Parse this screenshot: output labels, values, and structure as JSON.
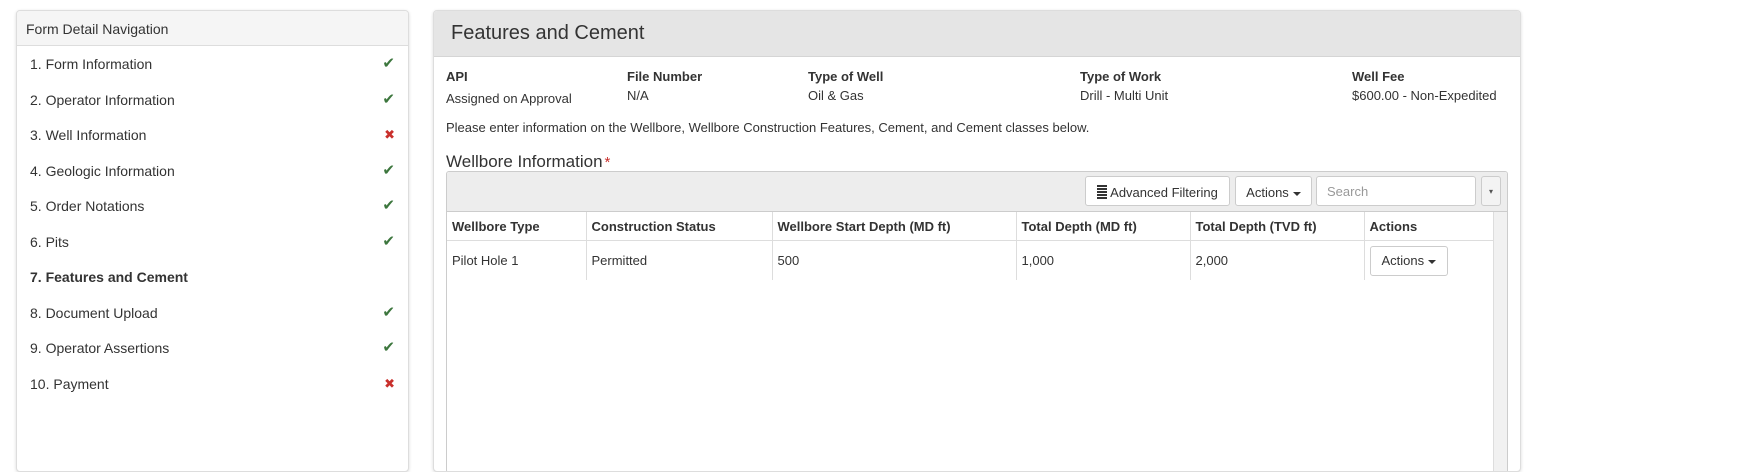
{
  "sidebar": {
    "title": "Form Detail Navigation",
    "items": [
      {
        "label": "1. Form Information",
        "status": "ok"
      },
      {
        "label": "2. Operator Information",
        "status": "ok"
      },
      {
        "label": "3. Well Information",
        "status": "bad"
      },
      {
        "label": "4. Geologic Information",
        "status": "ok"
      },
      {
        "label": "5. Order Notations",
        "status": "ok"
      },
      {
        "label": "6. Pits",
        "status": "ok"
      },
      {
        "label": "7. Features and Cement",
        "status": "active"
      },
      {
        "label": "8. Document Upload",
        "status": "ok"
      },
      {
        "label": "9. Operator Assertions",
        "status": "ok"
      },
      {
        "label": "10. Payment",
        "status": "bad"
      }
    ],
    "check_icon": "✔",
    "cross_icon": "✖"
  },
  "main": {
    "title": "Features and Cement",
    "info": {
      "api": {
        "label": "API",
        "value": "Assigned on Approval"
      },
      "file_number": {
        "label": "File Number",
        "value": "N/A"
      },
      "type_of_well": {
        "label": "Type of Well",
        "value": "Oil & Gas"
      },
      "type_of_work": {
        "label": "Type of Work",
        "value": "Drill - Multi Unit"
      },
      "well_fee": {
        "label": "Well Fee",
        "value": "$600.00 - Non-Expedited"
      }
    },
    "instructions": "Please enter information on the Wellbore, Wellbore Construction Features, Cement, and Cement classes below.",
    "section_title": "Wellbore Information",
    "required_marker": "*"
  },
  "grid": {
    "toolbar": {
      "advanced_filtering": "Advanced Filtering",
      "actions": "Actions",
      "search_placeholder": "Search",
      "dropdown_glyph": "▾"
    },
    "columns": [
      "Wellbore Type",
      "Construction Status",
      "Wellbore Start Depth (MD ft)",
      "Total Depth (MD ft)",
      "Total Depth (TVD ft)",
      "Actions"
    ],
    "rows": [
      {
        "cells": [
          "Pilot Hole 1",
          "Permitted",
          "500",
          "1,000",
          "2,000"
        ],
        "action": "Actions"
      }
    ]
  },
  "colors": {
    "ok": "#3c763d",
    "bad": "#c9302c",
    "header_bg": "#e5e5e5"
  }
}
